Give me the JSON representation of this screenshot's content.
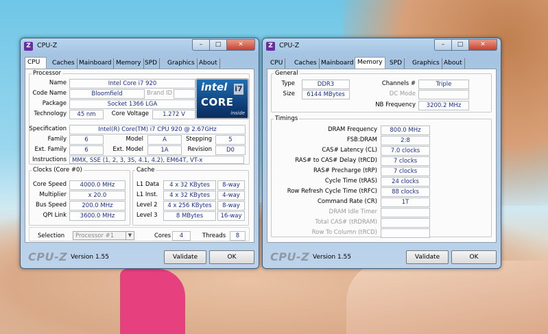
{
  "left": {
    "title": "CPU-Z",
    "tabs": [
      "CPU",
      "Caches",
      "Mainboard",
      "Memory",
      "SPD",
      "Graphics",
      "About"
    ],
    "processor": {
      "legend": "Processor",
      "name_label": "Name",
      "name": "Intel Core i7 920",
      "code_label": "Code Name",
      "code": "Bloomfield",
      "brand_label": "Brand ID",
      "package_label": "Package",
      "package": "Socket 1366 LGA",
      "tech_label": "Technology",
      "tech": "45 nm",
      "voltage_label": "Core Voltage",
      "voltage": "1.272 V",
      "spec_label": "Specification",
      "spec": "Intel(R) Core(TM) i7 CPU         920  @ 2.67GHz",
      "family_label": "Family",
      "family": "6",
      "model_label": "Model",
      "model": "A",
      "stepping_label": "Stepping",
      "stepping": "5",
      "extfam_label": "Ext. Family",
      "extfam": "6",
      "extmodel_label": "Ext. Model",
      "extmodel": "1A",
      "revision_label": "Revision",
      "revision": "D0",
      "instr_label": "Instructions",
      "instr": "MMX, SSE (1, 2, 3, 3S, 4.1, 4.2), EM64T, VT-x"
    },
    "logo": {
      "intel": "intel",
      "i7": "i7",
      "core": "CORE",
      "inside": "inside"
    },
    "clocks": {
      "legend": "Clocks (Core #0)",
      "core_speed_label": "Core Speed",
      "core_speed": "4000.0 MHz",
      "multiplier_label": "Multiplier",
      "multiplier": "x 20.0",
      "bus_label": "Bus Speed",
      "bus": "200.0 MHz",
      "qpi_label": "QPI Link",
      "qpi": "3600.0 MHz"
    },
    "cache": {
      "legend": "Cache",
      "rows": [
        {
          "label": "L1 Data",
          "size": "4 x 32 KBytes",
          "way": "8-way"
        },
        {
          "label": "L1 Inst.",
          "size": "4 x 32 KBytes",
          "way": "4-way"
        },
        {
          "label": "Level 2",
          "size": "4 x 256 KBytes",
          "way": "8-way"
        },
        {
          "label": "Level 3",
          "size": "8 MBytes",
          "way": "16-way"
        }
      ]
    },
    "selection": {
      "label": "Selection",
      "value": "Processor #1",
      "cores_label": "Cores",
      "cores": "4",
      "threads_label": "Threads",
      "threads": "8"
    },
    "footer": {
      "brand": "CPU-Z",
      "version": "Version 1.55",
      "validate": "Validate",
      "ok": "OK"
    }
  },
  "right": {
    "title": "CPU-Z",
    "tabs": [
      "CPU",
      "Caches",
      "Mainboard",
      "Memory",
      "SPD",
      "Graphics",
      "About"
    ],
    "general": {
      "legend": "General",
      "type_label": "Type",
      "type": "DDR3",
      "size_label": "Size",
      "size": "6144 MBytes",
      "channels_label": "Channels #",
      "channels": "Triple",
      "dcmode_label": "DC Mode",
      "nbfreq_label": "NB Frequency",
      "nbfreq": "3200.2 MHz"
    },
    "timings": {
      "legend": "Timings",
      "rows": [
        {
          "label": "DRAM Frequency",
          "value": "800.0 MHz"
        },
        {
          "label": "FSB:DRAM",
          "value": "2:8"
        },
        {
          "label": "CAS# Latency (CL)",
          "value": "7.0 clocks"
        },
        {
          "label": "RAS# to CAS# Delay (tRCD)",
          "value": "7 clocks"
        },
        {
          "label": "RAS# Precharge (tRP)",
          "value": "7 clocks"
        },
        {
          "label": "Cycle Time (tRAS)",
          "value": "24 clocks"
        },
        {
          "label": "Row Refresh Cycle Time (tRFC)",
          "value": "88 clocks"
        },
        {
          "label": "Command Rate (CR)",
          "value": "1T"
        }
      ],
      "disabled_rows": [
        "DRAM Idle Timer",
        "Total CAS# (tRDRAM)",
        "Row To Column (tRCD)"
      ]
    },
    "footer": {
      "brand": "CPU-Z",
      "version": "Version 1.55",
      "validate": "Validate",
      "ok": "OK"
    }
  }
}
